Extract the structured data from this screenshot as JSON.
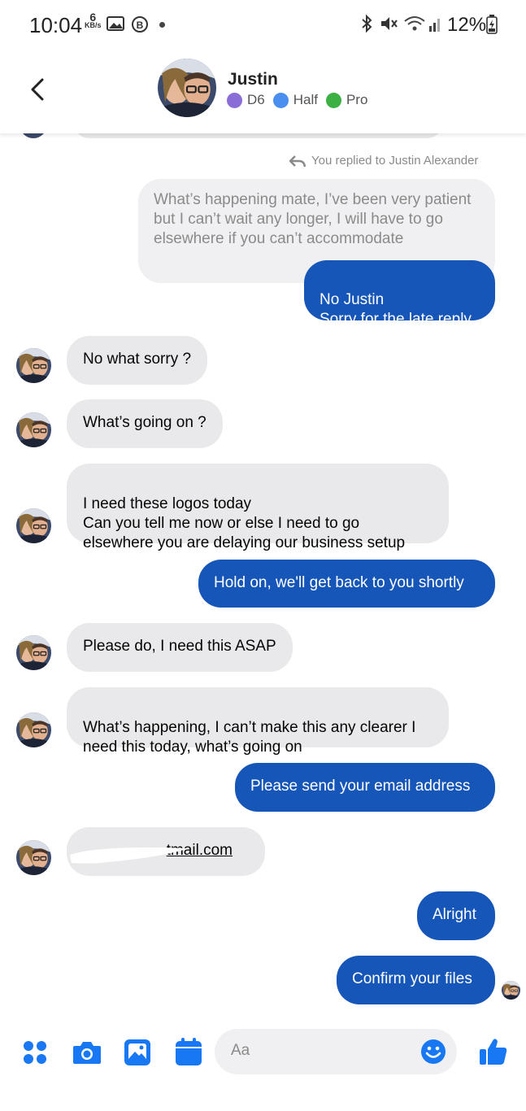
{
  "status_bar": {
    "time": "10:04",
    "net_speed_value": "6",
    "net_speed_unit": "KB/s",
    "battery": "12%"
  },
  "header": {
    "contact_name": "Justin",
    "tags": [
      {
        "label": "D6",
        "color": "#8a6dd6"
      },
      {
        "label": "Half",
        "color": "#4a8ef0"
      },
      {
        "label": "Pro",
        "color": "#3cb043"
      }
    ]
  },
  "thread": {
    "replied_note": "You replied to Justin Alexander",
    "quoted_message": "What’s happening mate, I’ve been very patient but I can’t wait any longer, I will have to go elsewhere if you can’t accommodate",
    "messages": [
      {
        "from": "me",
        "text": "No Justin\nSorry for the late reply"
      },
      {
        "from": "them",
        "text": "No what sorry ?"
      },
      {
        "from": "them",
        "text": "What’s going on ?"
      },
      {
        "from": "them",
        "text": "I need these logos today\nCan you tell me now or else I need to go\nelsewhere you are delaying our business setup"
      },
      {
        "from": "me",
        "text": "Hold on, we'll get back to you shortly"
      },
      {
        "from": "them",
        "text": "Please do, I need this ASAP"
      },
      {
        "from": "them",
        "text": "What’s happening, I can’t make this any clearer I\nneed this today, what’s going on"
      },
      {
        "from": "me",
        "text": "Please send your email address"
      },
      {
        "from": "them",
        "text": "tmail.com"
      },
      {
        "from": "me",
        "text": "Alright"
      },
      {
        "from": "me",
        "text": "Confirm your files"
      }
    ]
  },
  "composer": {
    "placeholder": "Aa",
    "icons": [
      "apps-icon",
      "camera-icon",
      "gallery-icon",
      "calendar-icon",
      "emoji-icon",
      "thumbs-up-icon"
    ],
    "accent": "#1877f2"
  },
  "colors": {
    "outgoing": "#1556b8",
    "incoming": "#e9e9eb"
  }
}
